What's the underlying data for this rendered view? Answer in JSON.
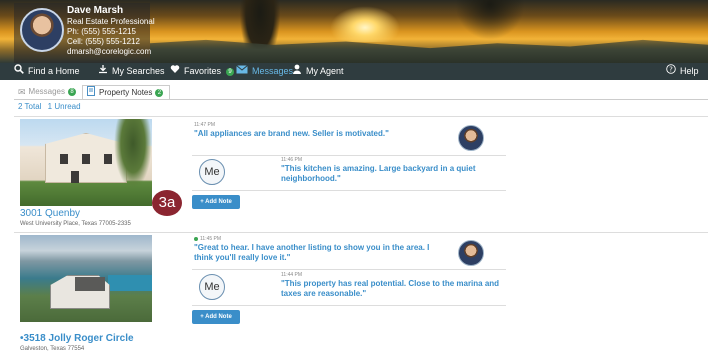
{
  "agent": {
    "name": "Dave Marsh",
    "role": "Real Estate Professional",
    "phone": "Ph: (555) 555-1215",
    "cell": "Cell: (555) 555-1212",
    "email": "dmarsh@corelogic.com"
  },
  "nav": {
    "find_home": "Find a Home",
    "my_searches": "My Searches",
    "favorites": "Favorites",
    "messages": "Messages",
    "messages_badge": "9",
    "my_agent": "My Agent",
    "help": "Help"
  },
  "tabs": {
    "messages": "Messages",
    "messages_badge": "8",
    "property_notes": "Property Notes",
    "property_notes_badge": "2"
  },
  "counts": {
    "total": "2 Total",
    "unread": "1 Unread"
  },
  "marker_label": "3a",
  "add_note_label": "+ Add Note",
  "me_label": "Me",
  "properties": [
    {
      "title": "3001 Quenby",
      "address": "West University Place, Texas 77005-2335",
      "notes": [
        {
          "time": "11:47 PM",
          "line1": "\"All appliances are brand new. Seller is motivated.\"",
          "line2": ""
        },
        {
          "time": "11:46 PM",
          "line1": "\"This kitchen is amazing. Large backyard in a quiet",
          "line2": "neighborhood.\""
        }
      ]
    },
    {
      "title": "•3518 Jolly Roger Circle",
      "address": "Galveston, Texas 77554",
      "notes": [
        {
          "time": "11:45 PM",
          "line1": "\"Great to hear. I have another listing to show you in the area. I",
          "line2": "think you'll really love it.\""
        },
        {
          "time": "11:44 PM",
          "line1": "\"This property has real potential. Close to the marina and",
          "line2": "taxes are reasonable.\""
        }
      ]
    }
  ],
  "colors": {
    "accent": "#3a8ec9",
    "nav_bg": "#2f3c3f",
    "badge_green": "#3aa552",
    "marker": "#8b2530"
  }
}
